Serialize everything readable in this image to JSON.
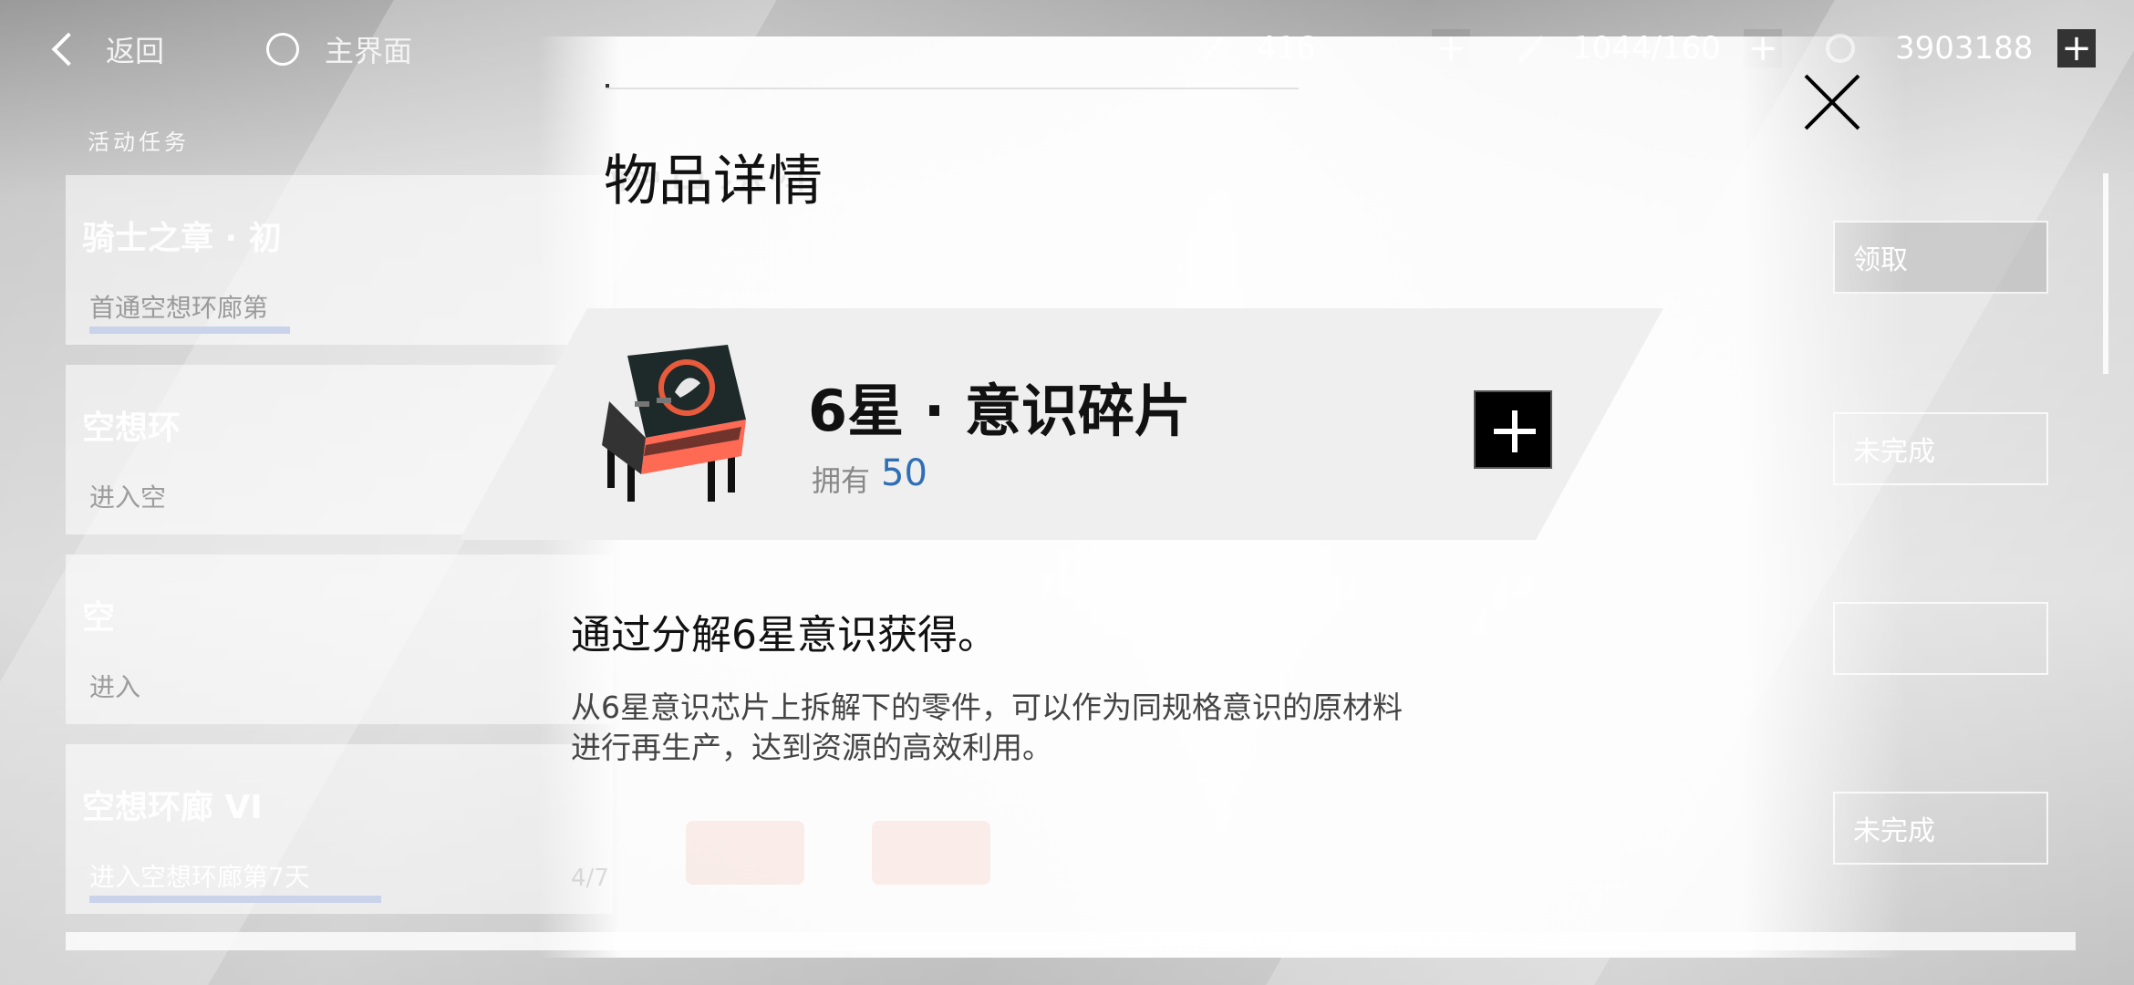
{
  "topbar": {
    "back_label": "返回",
    "home_label": "主界面",
    "resources": [
      {
        "icon": "stamina-pen-icon",
        "value": "416"
      },
      {
        "icon": "energy-brush-icon",
        "value": "1044/160"
      },
      {
        "icon": "coin-icon",
        "value": "3903188"
      }
    ]
  },
  "background": {
    "section_label": "活动任务",
    "cards": [
      {
        "title": "骑士之章 · 初",
        "sub": "首通空想环廊第",
        "button": "领取"
      },
      {
        "title": "空想环",
        "sub": "进入空",
        "button": "未完成"
      },
      {
        "title": "空",
        "sub": "进入",
        "button": ""
      },
      {
        "title": "空想环廊 VI",
        "sub": "进入空想环廊第7天",
        "button": "未完成"
      }
    ]
  },
  "modal": {
    "title": "物品详情",
    "item": {
      "name": "6星 · 意识碎片",
      "own_label": "拥有",
      "own_count": "50",
      "icon": "consciousness-chip-icon"
    },
    "description_main": "通过分解6星意识获得。",
    "description_detail": "从6星意识芯片上拆解下的零件，可以作为同规格意识的原材料进行再生产，达到资源的高效利用。",
    "ghost_progress": "4/7"
  },
  "colors": {
    "accent_blue": "#2f6fb5",
    "title_black": "#111111",
    "chip_red": "#ff5a44"
  }
}
